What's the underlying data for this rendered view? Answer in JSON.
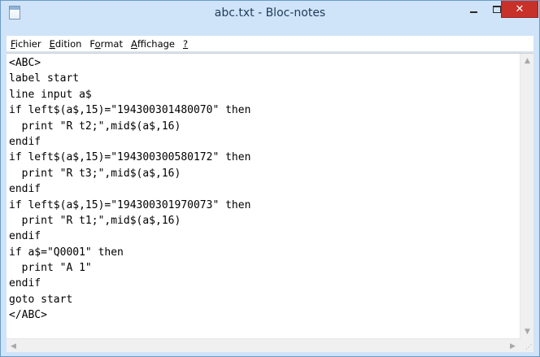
{
  "window": {
    "title": "abc.txt - Bloc-notes",
    "icon": "notepad-icon"
  },
  "titlebar_buttons": {
    "minimize_icon": "minimize-icon",
    "maximize_icon": "maximize-icon",
    "close_glyph": "✕"
  },
  "menu": {
    "items": [
      {
        "accel": "F",
        "rest": "ichier"
      },
      {
        "accel": "E",
        "rest": "dition"
      },
      {
        "pre": "F",
        "accel": "o",
        "rest": "rmat"
      },
      {
        "accel": "A",
        "rest": "ffichage"
      },
      {
        "accel": "?",
        "rest": ""
      }
    ]
  },
  "editor": {
    "lines": [
      "<ABC>",
      "label start",
      "line input a$",
      "if left$(a$,15)=\"194300301480070\" then",
      "  print \"R t2;\",mid$(a$,16)",
      "endif",
      "if left$(a$,15)=\"194300300580172\" then",
      "  print \"R t3;\",mid$(a$,16)",
      "endif",
      "if left$(a$,15)=\"194300301970073\" then",
      "  print \"R t1;\",mid$(a$,16)",
      "endif",
      "if a$=\"Q0001\" then",
      "  print \"A 1\"",
      "endif",
      "goto start",
      "</ABC>"
    ]
  },
  "scrollbars": {
    "up": "▲",
    "down": "▼",
    "left": "◀",
    "right": "▶",
    "grip": "⋰"
  }
}
